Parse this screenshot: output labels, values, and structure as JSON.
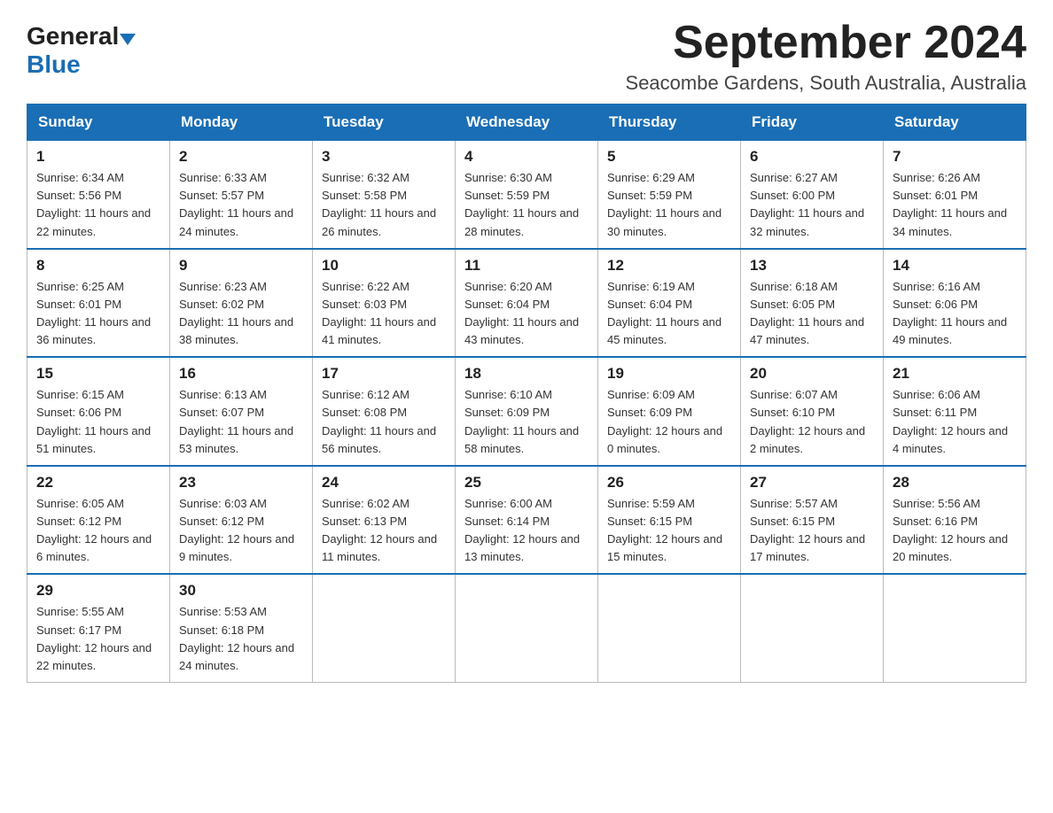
{
  "header": {
    "title": "September 2024",
    "location": "Seacombe Gardens, South Australia, Australia",
    "logo_general": "General",
    "logo_blue": "Blue"
  },
  "days_of_week": [
    "Sunday",
    "Monday",
    "Tuesday",
    "Wednesday",
    "Thursday",
    "Friday",
    "Saturday"
  ],
  "weeks": [
    [
      {
        "num": "1",
        "sunrise": "Sunrise: 6:34 AM",
        "sunset": "Sunset: 5:56 PM",
        "daylight": "Daylight: 11 hours and 22 minutes."
      },
      {
        "num": "2",
        "sunrise": "Sunrise: 6:33 AM",
        "sunset": "Sunset: 5:57 PM",
        "daylight": "Daylight: 11 hours and 24 minutes."
      },
      {
        "num": "3",
        "sunrise": "Sunrise: 6:32 AM",
        "sunset": "Sunset: 5:58 PM",
        "daylight": "Daylight: 11 hours and 26 minutes."
      },
      {
        "num": "4",
        "sunrise": "Sunrise: 6:30 AM",
        "sunset": "Sunset: 5:59 PM",
        "daylight": "Daylight: 11 hours and 28 minutes."
      },
      {
        "num": "5",
        "sunrise": "Sunrise: 6:29 AM",
        "sunset": "Sunset: 5:59 PM",
        "daylight": "Daylight: 11 hours and 30 minutes."
      },
      {
        "num": "6",
        "sunrise": "Sunrise: 6:27 AM",
        "sunset": "Sunset: 6:00 PM",
        "daylight": "Daylight: 11 hours and 32 minutes."
      },
      {
        "num": "7",
        "sunrise": "Sunrise: 6:26 AM",
        "sunset": "Sunset: 6:01 PM",
        "daylight": "Daylight: 11 hours and 34 minutes."
      }
    ],
    [
      {
        "num": "8",
        "sunrise": "Sunrise: 6:25 AM",
        "sunset": "Sunset: 6:01 PM",
        "daylight": "Daylight: 11 hours and 36 minutes."
      },
      {
        "num": "9",
        "sunrise": "Sunrise: 6:23 AM",
        "sunset": "Sunset: 6:02 PM",
        "daylight": "Daylight: 11 hours and 38 minutes."
      },
      {
        "num": "10",
        "sunrise": "Sunrise: 6:22 AM",
        "sunset": "Sunset: 6:03 PM",
        "daylight": "Daylight: 11 hours and 41 minutes."
      },
      {
        "num": "11",
        "sunrise": "Sunrise: 6:20 AM",
        "sunset": "Sunset: 6:04 PM",
        "daylight": "Daylight: 11 hours and 43 minutes."
      },
      {
        "num": "12",
        "sunrise": "Sunrise: 6:19 AM",
        "sunset": "Sunset: 6:04 PM",
        "daylight": "Daylight: 11 hours and 45 minutes."
      },
      {
        "num": "13",
        "sunrise": "Sunrise: 6:18 AM",
        "sunset": "Sunset: 6:05 PM",
        "daylight": "Daylight: 11 hours and 47 minutes."
      },
      {
        "num": "14",
        "sunrise": "Sunrise: 6:16 AM",
        "sunset": "Sunset: 6:06 PM",
        "daylight": "Daylight: 11 hours and 49 minutes."
      }
    ],
    [
      {
        "num": "15",
        "sunrise": "Sunrise: 6:15 AM",
        "sunset": "Sunset: 6:06 PM",
        "daylight": "Daylight: 11 hours and 51 minutes."
      },
      {
        "num": "16",
        "sunrise": "Sunrise: 6:13 AM",
        "sunset": "Sunset: 6:07 PM",
        "daylight": "Daylight: 11 hours and 53 minutes."
      },
      {
        "num": "17",
        "sunrise": "Sunrise: 6:12 AM",
        "sunset": "Sunset: 6:08 PM",
        "daylight": "Daylight: 11 hours and 56 minutes."
      },
      {
        "num": "18",
        "sunrise": "Sunrise: 6:10 AM",
        "sunset": "Sunset: 6:09 PM",
        "daylight": "Daylight: 11 hours and 58 minutes."
      },
      {
        "num": "19",
        "sunrise": "Sunrise: 6:09 AM",
        "sunset": "Sunset: 6:09 PM",
        "daylight": "Daylight: 12 hours and 0 minutes."
      },
      {
        "num": "20",
        "sunrise": "Sunrise: 6:07 AM",
        "sunset": "Sunset: 6:10 PM",
        "daylight": "Daylight: 12 hours and 2 minutes."
      },
      {
        "num": "21",
        "sunrise": "Sunrise: 6:06 AM",
        "sunset": "Sunset: 6:11 PM",
        "daylight": "Daylight: 12 hours and 4 minutes."
      }
    ],
    [
      {
        "num": "22",
        "sunrise": "Sunrise: 6:05 AM",
        "sunset": "Sunset: 6:12 PM",
        "daylight": "Daylight: 12 hours and 6 minutes."
      },
      {
        "num": "23",
        "sunrise": "Sunrise: 6:03 AM",
        "sunset": "Sunset: 6:12 PM",
        "daylight": "Daylight: 12 hours and 9 minutes."
      },
      {
        "num": "24",
        "sunrise": "Sunrise: 6:02 AM",
        "sunset": "Sunset: 6:13 PM",
        "daylight": "Daylight: 12 hours and 11 minutes."
      },
      {
        "num": "25",
        "sunrise": "Sunrise: 6:00 AM",
        "sunset": "Sunset: 6:14 PM",
        "daylight": "Daylight: 12 hours and 13 minutes."
      },
      {
        "num": "26",
        "sunrise": "Sunrise: 5:59 AM",
        "sunset": "Sunset: 6:15 PM",
        "daylight": "Daylight: 12 hours and 15 minutes."
      },
      {
        "num": "27",
        "sunrise": "Sunrise: 5:57 AM",
        "sunset": "Sunset: 6:15 PM",
        "daylight": "Daylight: 12 hours and 17 minutes."
      },
      {
        "num": "28",
        "sunrise": "Sunrise: 5:56 AM",
        "sunset": "Sunset: 6:16 PM",
        "daylight": "Daylight: 12 hours and 20 minutes."
      }
    ],
    [
      {
        "num": "29",
        "sunrise": "Sunrise: 5:55 AM",
        "sunset": "Sunset: 6:17 PM",
        "daylight": "Daylight: 12 hours and 22 minutes."
      },
      {
        "num": "30",
        "sunrise": "Sunrise: 5:53 AM",
        "sunset": "Sunset: 6:18 PM",
        "daylight": "Daylight: 12 hours and 24 minutes."
      },
      null,
      null,
      null,
      null,
      null
    ]
  ]
}
